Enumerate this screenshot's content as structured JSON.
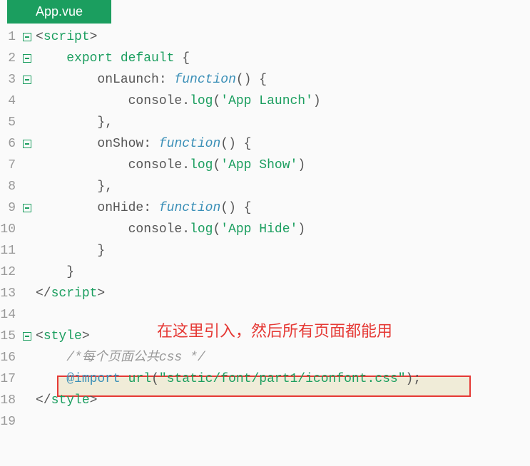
{
  "tab": {
    "filename": "App.vue"
  },
  "note": "在这里引入，然后所有页面都能用",
  "lines": {
    "1": {
      "open": "<",
      "tag": "script",
      "close": ">"
    },
    "2": {
      "kw": "export default",
      "brace": " {"
    },
    "3": {
      "name": "onLaunch",
      "colon": ": ",
      "fn": "function",
      "paren": "() {"
    },
    "4": {
      "obj": "console",
      "dot": ".",
      "method": "log",
      "open": "(",
      "str": "'App Launch'",
      "close": ")"
    },
    "5": {
      "text": "},"
    },
    "6": {
      "name": "onShow",
      "colon": ": ",
      "fn": "function",
      "paren": "() {"
    },
    "7": {
      "obj": "console",
      "dot": ".",
      "method": "log",
      "open": "(",
      "str": "'App Show'",
      "close": ")"
    },
    "8": {
      "text": "},"
    },
    "9": {
      "name": "onHide",
      "colon": ": ",
      "fn": "function",
      "paren": "() {"
    },
    "10": {
      "obj": "console",
      "dot": ".",
      "method": "log",
      "open": "(",
      "str": "'App Hide'",
      "close": ")"
    },
    "11": {
      "text": "}"
    },
    "12": {
      "text": "}"
    },
    "13": {
      "open": "</",
      "tag": "script",
      "close": ">"
    },
    "15": {
      "open": "<",
      "tag": "style",
      "close": ">"
    },
    "16": {
      "comment": "/*每个页面公共css */"
    },
    "17": {
      "import": "@import",
      "sp": " ",
      "urlkw": "url",
      "open": "(",
      "str": "\"static/font/part1/iconfont.css\"",
      "close": ");"
    },
    "18": {
      "open": "</",
      "tag": "style",
      "close": ">"
    }
  },
  "lineNumbers": [
    "1",
    "2",
    "3",
    "4",
    "5",
    "6",
    "7",
    "8",
    "9",
    "10",
    "11",
    "12",
    "13",
    "14",
    "15",
    "16",
    "17",
    "18",
    "19"
  ],
  "folds": {
    "1": true,
    "2": true,
    "3": true,
    "6": true,
    "9": true,
    "15": true
  }
}
